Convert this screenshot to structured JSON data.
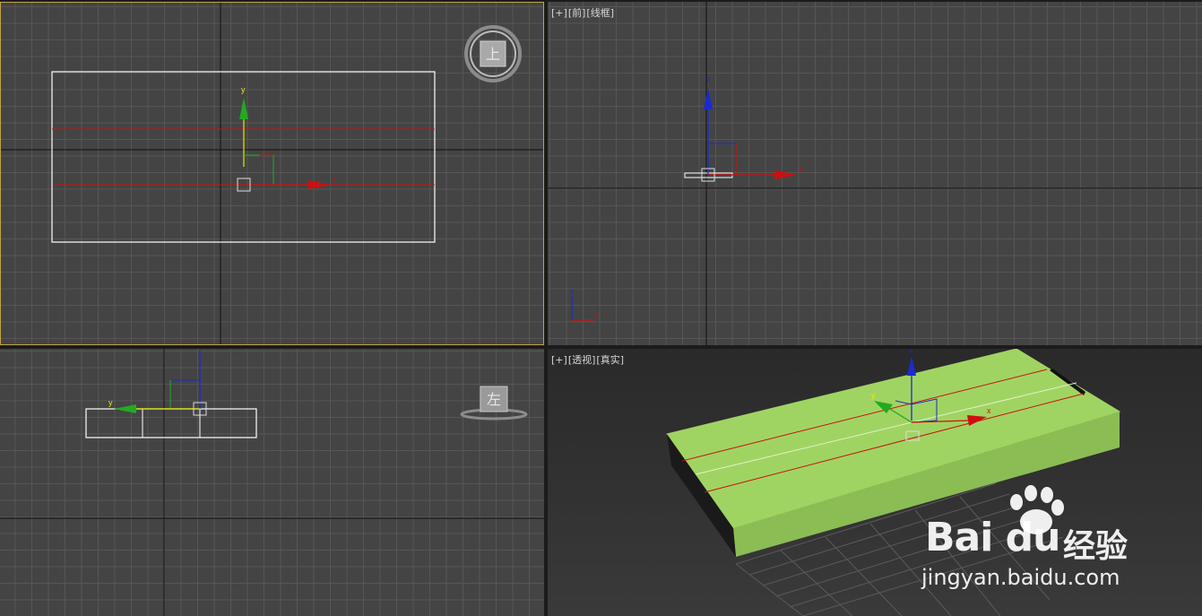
{
  "viewports": {
    "top": {
      "viewcube_label": "上"
    },
    "front": {
      "label": {
        "plus": "[+]",
        "view": "[前]",
        "shading": "[线框]"
      }
    },
    "left": {
      "viewcube_label": "左"
    },
    "perspective": {
      "label": {
        "plus": "[+]",
        "view": "[透视]",
        "shading": "[真实]"
      }
    }
  },
  "gizmo": {
    "x": "x",
    "y": "y",
    "z": "z"
  },
  "colors": {
    "grid_bg": "#444444",
    "active_border": "#c0a34b",
    "axis_x": "#cc1010",
    "axis_y": "#22aa22",
    "axis_z": "#1a2ad0",
    "box": "#9ccf5e"
  },
  "watermark": {
    "logo": "Bai du",
    "brand_cn": "经验",
    "url": "jingyan.baidu.com"
  }
}
